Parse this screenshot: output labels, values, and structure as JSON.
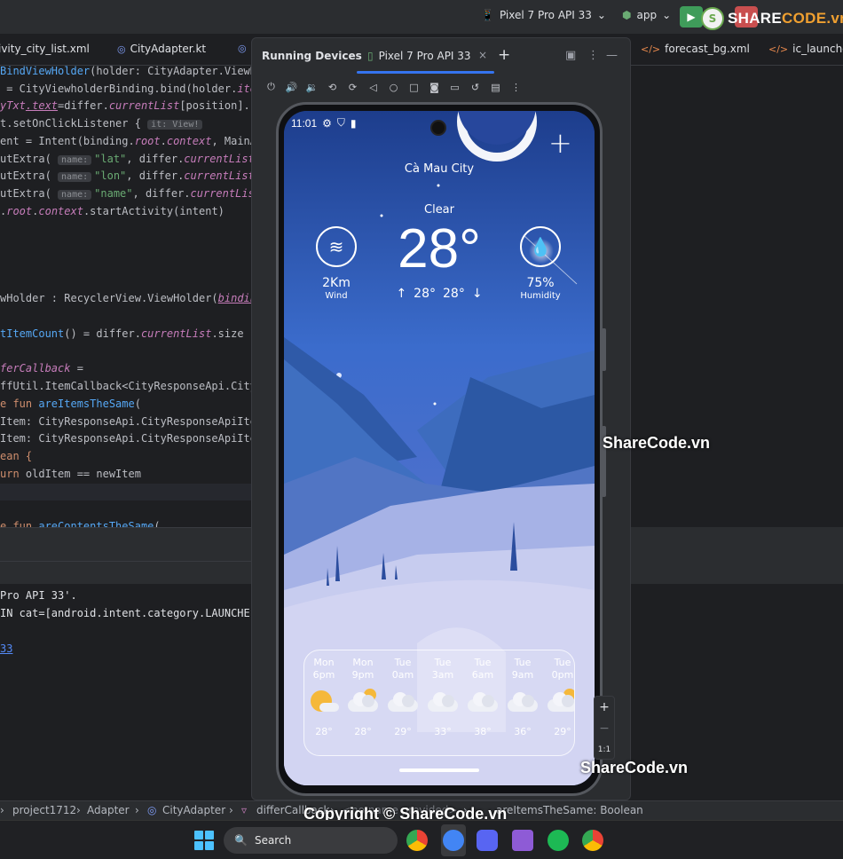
{
  "toolbar": {
    "device": "Pixel 7 Pro API 33",
    "app": "app",
    "brand": {
      "icon_letter": "S",
      "prefix": "SHARE",
      "suffix": "CODE.vn"
    }
  },
  "file_tabs": [
    {
      "name": "ivity_city_list.xml",
      "type": "xml"
    },
    {
      "name": "CityAdapter.kt",
      "type": "kt"
    },
    {
      "name": "forecast_bg.xml",
      "type": "xml"
    },
    {
      "name": "ic_launcher_",
      "type": "xml"
    }
  ],
  "code": {
    "l1": {
      "a": "BindViewHolder",
      "b": "(holder: CityAdapter.ViewH"
    },
    "l2": {
      "a": " = CityViewholderBinding.bind(holder.",
      "b": "ite"
    },
    "l3": {
      "a": "yTxt",
      "b": ".text",
      "c": "=differ.",
      "d": "currentList",
      "e": "[position].r"
    },
    "l4": {
      "a": "t.setOnClickListener { ",
      "hint": "it: View!"
    },
    "l5": {
      "a": "ent = Intent(binding.",
      "b": "root",
      "c": ".",
      "d": "context",
      "e": ", MainA"
    },
    "l6": {
      "a": "utExtra( ",
      "hint": "name:",
      "str": "\"lat\"",
      "b": ", differ.",
      "c": "currentList"
    },
    "l7": {
      "a": "utExtra( ",
      "hint": "name:",
      "str": "\"lon\"",
      "b": ", differ.",
      "c": "currentList"
    },
    "l8": {
      "a": "utExtra( ",
      "hint": "name:",
      "str": "\"name\"",
      "b": ", differ.",
      "c": "currentLis"
    },
    "l9": {
      "a": ".",
      "b": "root",
      "c": ".",
      "d": "context",
      "e": ".startActivity(intent)"
    },
    "l10": {
      "a": "wHolder : RecyclerView.ViewHolder(",
      "b": "bindin"
    },
    "l11": {
      "a": "tItemCount",
      "b": "() = differ.",
      "c": "currentList",
      "d": ".size"
    },
    "l12": {
      "a": "ferCallback",
      "b": " ="
    },
    "l13": {
      "a": "ffUtil.ItemCallback<CityResponseApi.City"
    },
    "l14": {
      "a": "e fun ",
      "b": "areItemsTheSame",
      "c": "("
    },
    "l15": {
      "a": "Item: CityResponseApi.CityResponseApiIte"
    },
    "l16": {
      "a": "Item: CityResponseApi.CityResponseApiIte"
    },
    "l17": {
      "a": "ean {"
    },
    "l18": {
      "a": "urn ",
      "b": "oldItem == newItem"
    },
    "l19": {
      "a": "e fun ",
      "b": "areContentsTheSame",
      "c": "("
    }
  },
  "run_output": {
    "l1": "Pro API 33'.",
    "l2": "IN cat=[android.intent.category.LAUNCHE",
    "l3": "33"
  },
  "running_devices": {
    "title": "Running Devices",
    "tab": "Pixel 7 Pro API 33",
    "close": "×",
    "add": "+"
  },
  "phone": {
    "status_time": "11:01",
    "city": "Cà Mau City",
    "condition": "Clear",
    "temperature": "28°",
    "max_temp": "28°",
    "min_temp": "28°",
    "wind": {
      "value": "2Km",
      "label": "Wind"
    },
    "humidity": {
      "value": "75%",
      "label": "Humidity"
    },
    "forecast": [
      {
        "day": "Mon",
        "hour": "6pm",
        "temp": "28°",
        "icon": "sunny"
      },
      {
        "day": "Mon",
        "hour": "9pm",
        "temp": "28°",
        "icon": "partly-cloudy"
      },
      {
        "day": "Tue",
        "hour": "0am",
        "temp": "29°",
        "icon": "cloudy"
      },
      {
        "day": "Tue",
        "hour": "3am",
        "temp": "33°",
        "icon": "cloudy"
      },
      {
        "day": "Tue",
        "hour": "6am",
        "temp": "38°",
        "icon": "cloudy"
      },
      {
        "day": "Tue",
        "hour": "9am",
        "temp": "36°",
        "icon": "cloudy"
      },
      {
        "day": "Tue",
        "hour": "0pm",
        "temp": "29°",
        "icon": "partly-cloudy"
      }
    ]
  },
  "zoom": {
    "in": "+",
    "out": "−",
    "reset": "1:1"
  },
  "watermarks": {
    "w1": "ShareCode.vn",
    "w2": "ShareCode.vn",
    "w3": "Copyright © ShareCode.vn"
  },
  "breadcrumb": {
    "project": "project1712",
    "adapter": "Adapter",
    "class": "CityAdapter",
    "member": "differCallback",
    "obscured": "<no name provided>",
    "method": "areItemsTheSame: Boolean"
  },
  "taskbar": {
    "search_placeholder": "Search"
  }
}
